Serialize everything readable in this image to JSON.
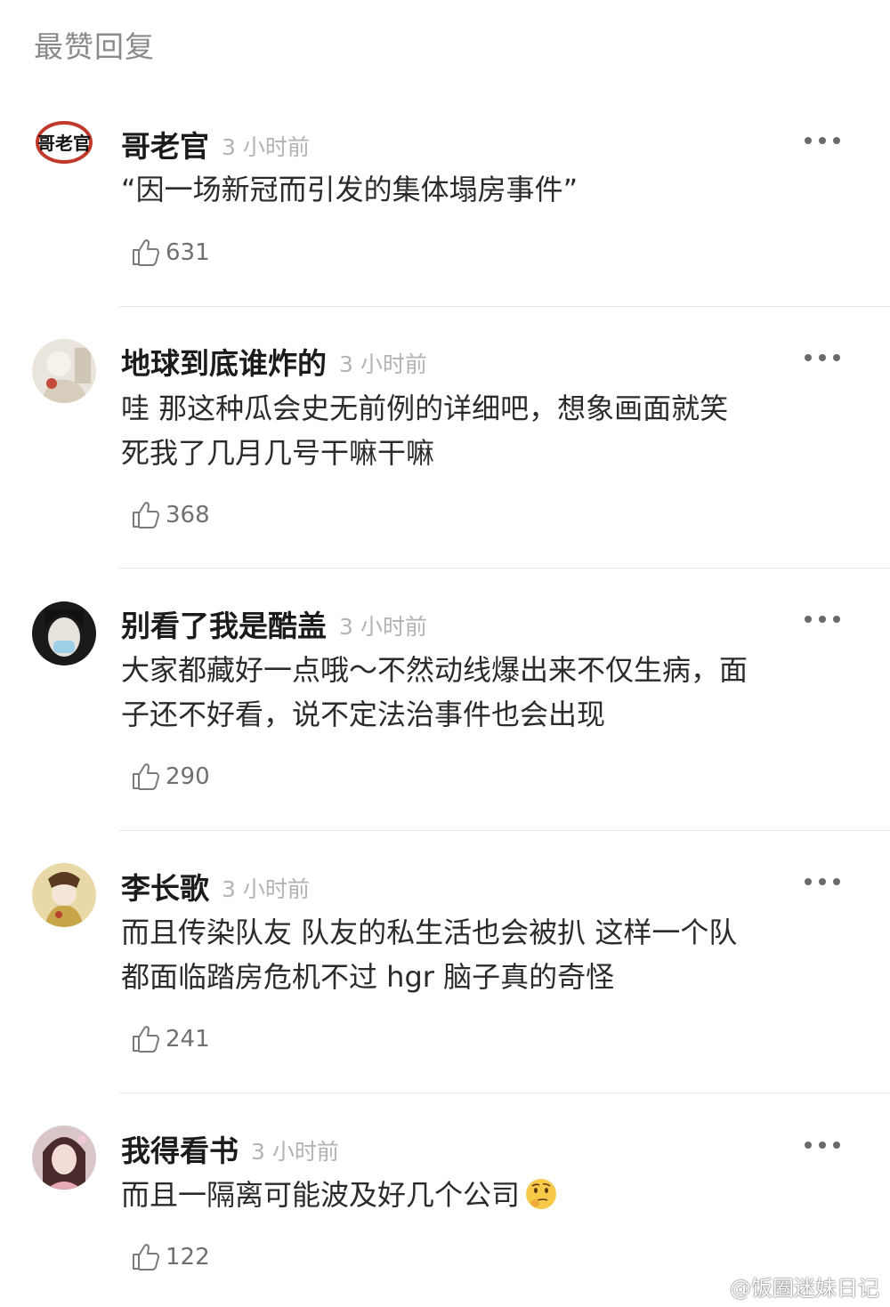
{
  "section_title": "最赞回复",
  "comments": [
    {
      "username": "哥老官",
      "time": "3 小时前",
      "lines": [
        "“因一场新冠而引发的集体塌房事件”"
      ],
      "likes": "631",
      "avatar_text": "哥老官"
    },
    {
      "username": "地球到底谁炸的",
      "time": "3 小时前",
      "lines": [
        "哇 那这种瓜会史无前例的详细吧，想象画面就笑",
        "死我了几月几号干嘛干嘛"
      ],
      "likes": "368"
    },
    {
      "username": "别看了我是酷盖",
      "time": "3 小时前",
      "lines": [
        "大家都藏好一点哦～不然动线爆出来不仅生病，面",
        "子还不好看，说不定法治事件也会出现"
      ],
      "likes": "290"
    },
    {
      "username": "李长歌",
      "time": "3 小时前",
      "lines": [
        "而且传染队友 队友的私生活也会被扒 这样一个队",
        "都面临踏房危机不过 hgr 脑子真的奇怪"
      ],
      "likes": "241"
    },
    {
      "username": "我得看书",
      "time": "3 小时前",
      "lines": [
        "而且一隔离可能波及好几个公司"
      ],
      "likes": "122",
      "emoji": "thinking-face"
    }
  ],
  "watermark": "@饭圈迷妹日记",
  "colors": {
    "username": "#1b1b1b",
    "timestamp": "#b3b3b3",
    "content": "#2b2b2b",
    "title": "#8a8a8a",
    "divider": "#e6e6e6"
  }
}
